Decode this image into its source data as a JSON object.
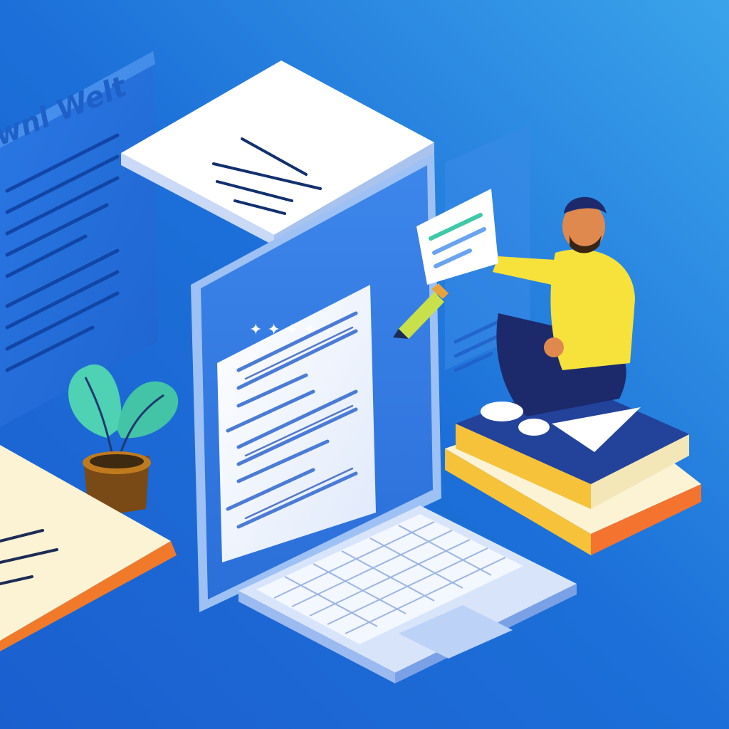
{
  "background": {
    "gradient_top_right": "#3aa3ea",
    "gradient_mid": "#1c6fd8",
    "gradient_bottom_left": "#1b5fcf"
  },
  "left_panel": {
    "heading": "wnl Welt",
    "color": "#1e5fc8"
  },
  "palette": {
    "shirt": "#f7e23b",
    "pants": "#1c2a6b",
    "skin": "#e0894f",
    "book_cover": "#1e3a8a",
    "book_pages": "#fbf3d4",
    "book_spine_orange": "#f3732f",
    "book_spine_yellow": "#f5c23a",
    "plant_leaf": "#4fd1b3",
    "pot": "#c07a1e",
    "pencil": "#c8e04a"
  },
  "icons": [
    "plant-icon",
    "pencil-icon",
    "person-icon",
    "book-stack-icon",
    "laptop-icon"
  ]
}
